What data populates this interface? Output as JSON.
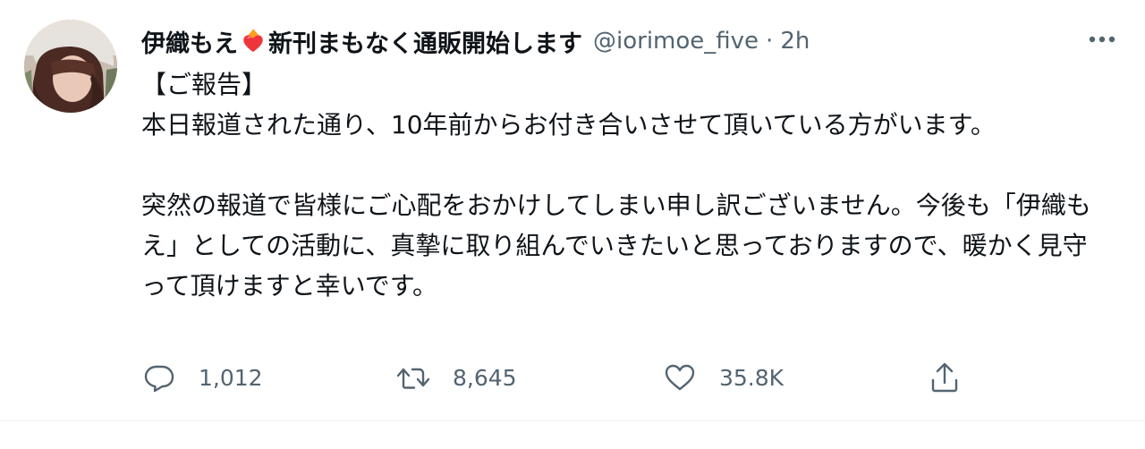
{
  "tweet": {
    "display_name_part1": "伊織もえ",
    "display_name_emoji": "heart-fire-emoji",
    "display_name_part2": "新刊まもなく通販開始します",
    "handle": "@iorimoe_five",
    "separator": "·",
    "time": "2h",
    "body": "【ご報告】\n本日報道された通り、10年前からお付き合いさせて頂いている方がいます。\n\n突然の報道で皆様にご心配をおかけしてしまい申し訳ございません。今後も「伊織もえ」としての活動に、真摯に取り組んでいきたいと思っておりますので、暖かく見守って頂けますと幸いです。",
    "reply_count": "1,012",
    "retweet_count": "8,645",
    "like_count": "35.8K"
  },
  "colors": {
    "text_primary": "#0f1419",
    "text_secondary": "#536471",
    "divider": "#eff3f4",
    "emoji_heart": "#f0343c",
    "emoji_flame": "#ff9f1c"
  },
  "icons": {
    "reply": "speech-bubble-icon",
    "retweet": "retweet-arrows-icon",
    "like": "heart-outline-icon",
    "share": "share-upload-icon",
    "more": "more-dots-icon"
  }
}
